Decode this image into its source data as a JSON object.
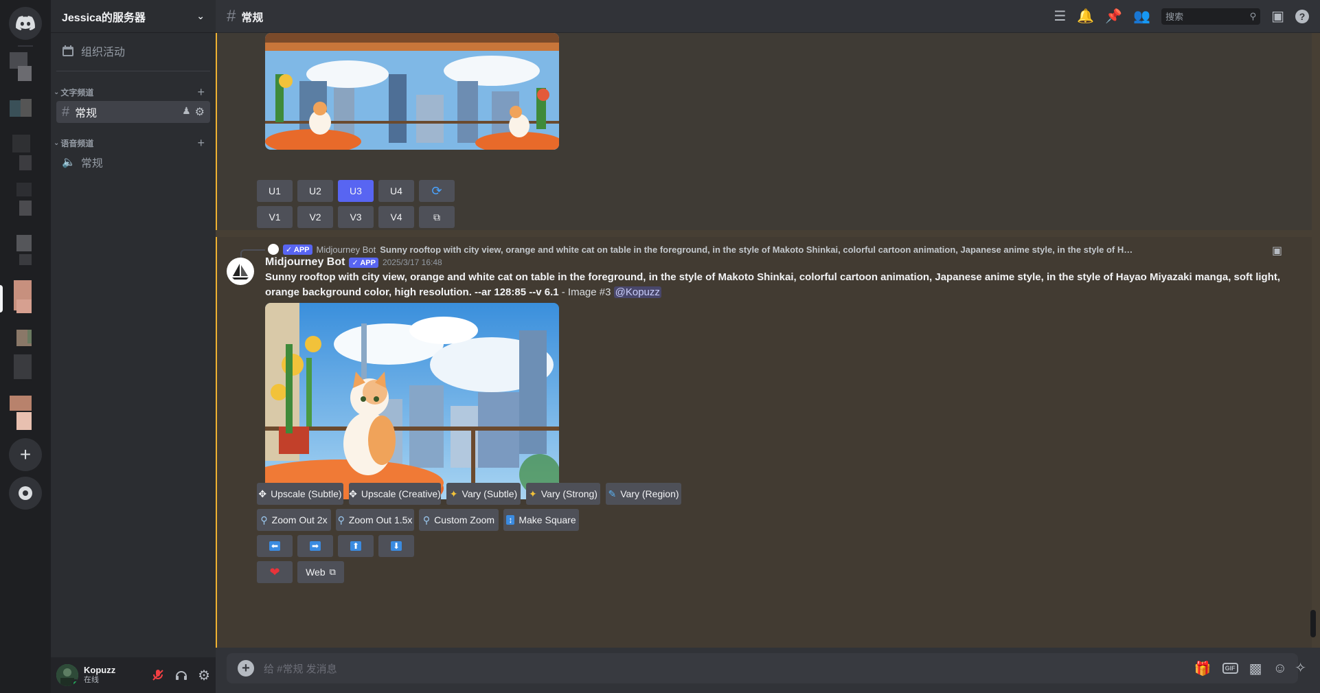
{
  "server": {
    "name": "Jessica的服务器",
    "event_label": "组织活动"
  },
  "categories": {
    "text": "文字频道",
    "voice": "语音频道"
  },
  "channels": {
    "text_general": "常规",
    "voice_general": "常规"
  },
  "topbar": {
    "channel_name": "常规",
    "search_placeholder": "搜索"
  },
  "user": {
    "name": "Kopuzz",
    "status": "在线"
  },
  "message1": {
    "buttons_row1": [
      "U1",
      "U2",
      "U3",
      "U4"
    ],
    "buttons_row2": [
      "V1",
      "V2",
      "V3",
      "V4"
    ],
    "selected": "U3"
  },
  "message2": {
    "reply_app_tag": "APP",
    "reply_author": "Midjourney Bot",
    "reply_text": "Sunny rooftop with city view, orange and white cat on table in the foreground, in the style of Makoto Shinkai, colorful cartoon animation, Japanese anime style, in the style of Hayao Miyazaki manga, soft lig...",
    "author": "Midjourney Bot",
    "app_tag": "APP",
    "timestamp": "2025/3/17 16:48",
    "prompt_bold": "Sunny rooftop with city view, orange and white cat on table in the foreground, in the style of Makoto Shinkai, colorful cartoon animation, Japanese anime style, in the style of Hayao Miyazaki manga, soft light, orange background color, high resolution. --ar 128:85 --v 6.1",
    "prompt_suffix": " - Image #3 ",
    "mention": "@Kopuzz",
    "buttons": {
      "upscale_subtle": "Upscale (Subtle)",
      "upscale_creative": "Upscale (Creative)",
      "vary_subtle": "Vary (Subtle)",
      "vary_strong": "Vary (Strong)",
      "vary_region": "Vary (Region)",
      "zoom_out_2x": "Zoom Out 2x",
      "zoom_out_15x": "Zoom Out 1.5x",
      "custom_zoom": "Custom Zoom",
      "make_square": "Make Square",
      "web": "Web"
    }
  },
  "composer": {
    "placeholder": "给 #常规 发消息"
  },
  "colors": {
    "accent": "#5865f2",
    "highlight_border": "#f0b232",
    "online": "#23a55a"
  }
}
